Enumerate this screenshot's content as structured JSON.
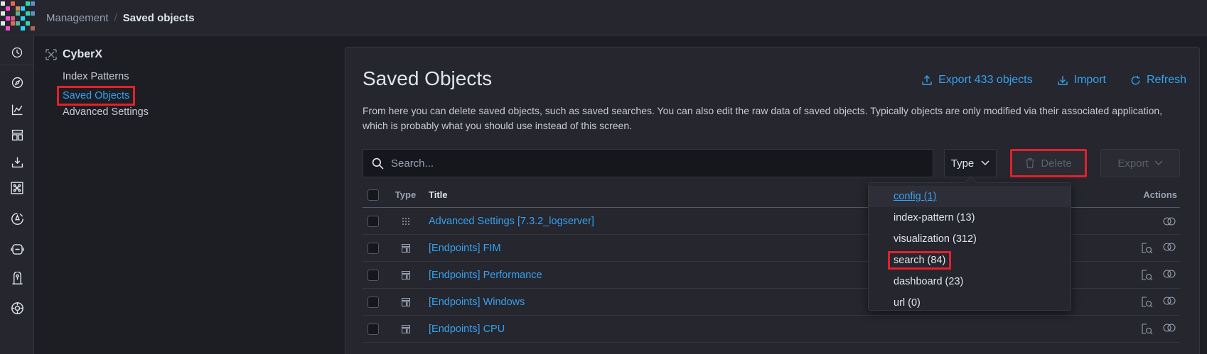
{
  "logo_colors": [
    "#e2e4e7",
    "#54b399",
    "#6092c0",
    "#d36086",
    "#9170b8",
    "#ca8eae",
    "#d6bf57",
    "#b9a888",
    "#da8b45",
    "#aa6556",
    "#e7664c",
    "#35d5a5",
    "#ff4dd8",
    "#24d5ff"
  ],
  "breadcrumbs": {
    "parent": "Management",
    "separator": "/",
    "current": "Saved objects"
  },
  "rail_icons": [
    "clock-icon",
    "compass-icon",
    "chart-icon",
    "dashboard-icon",
    "download-icon",
    "graph-icon",
    "ml-icon",
    "monitor-icon",
    "sensor-icon",
    "settings-icon"
  ],
  "sidenav": {
    "title": "CyberX",
    "items": [
      {
        "label": "Index Patterns"
      },
      {
        "label": "Saved Objects"
      },
      {
        "label": "Advanced Settings"
      }
    ]
  },
  "main": {
    "title": "Saved Objects",
    "export_all": "Export 433 objects",
    "import": "Import",
    "refresh": "Refresh",
    "description": "From here you can delete saved objects, such as saved searches. You can also edit the raw data of saved objects. Typically objects are only modified via their associated application, which is probably what you should use instead of this screen.",
    "search_placeholder": "Search...",
    "type_filter": "Type",
    "delete": "Delete",
    "export": "Export"
  },
  "table": {
    "headers": {
      "type": "Type",
      "title": "Title",
      "actions": "Actions"
    },
    "rows": [
      {
        "type_icon": "config-icon",
        "title": "Advanced Settings [7.3.2_logserver]"
      },
      {
        "type_icon": "search-object-icon",
        "title": "[Endpoints] FIM"
      },
      {
        "type_icon": "search-object-icon",
        "title": "[Endpoints] Performance"
      },
      {
        "type_icon": "search-object-icon",
        "title": "[Endpoints] Windows"
      },
      {
        "type_icon": "search-object-icon",
        "title": "[Endpoints] CPU"
      }
    ]
  },
  "type_dropdown": [
    {
      "label": "config (1)"
    },
    {
      "label": "index-pattern (13)"
    },
    {
      "label": "visualization (312)"
    },
    {
      "label": "search (84)"
    },
    {
      "label": "dashboard (23)"
    },
    {
      "label": "url (0)"
    }
  ]
}
